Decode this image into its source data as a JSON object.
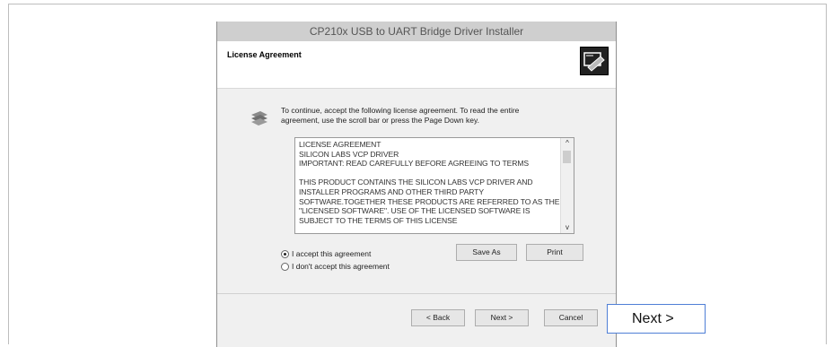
{
  "dialog": {
    "title": "CP210x USB to UART Bridge Driver Installer",
    "header_title": "License Agreement",
    "intro_line1": "To continue, accept the following license agreement. To read the entire",
    "intro_line2": "agreement, use the scroll bar or press the Page Down key.",
    "license_text": "LICENSE AGREEMENT\nSILICON LABS VCP DRIVER\nIMPORTANT:  READ CAREFULLY BEFORE AGREEING TO TERMS\n\nTHIS PRODUCT CONTAINS THE SILICON LABS VCP DRIVER AND INSTALLER PROGRAMS AND OTHER THIRD PARTY SOFTWARE.TOGETHER THESE PRODUCTS ARE REFERRED TO AS THE \"LICENSED SOFTWARE\".  USE OF THE LICENSED SOFTWARE IS SUBJECT TO THE TERMS OF THIS LICENSE",
    "radio_accept": "I accept this agreement",
    "radio_decline": "I don't accept this agreement",
    "accept_selected": true,
    "save_as_label": "Save As",
    "print_label": "Print",
    "back_label": "< Back",
    "next_label": "Next >",
    "cancel_label": "Cancel"
  },
  "callout": {
    "label": "Next >"
  }
}
